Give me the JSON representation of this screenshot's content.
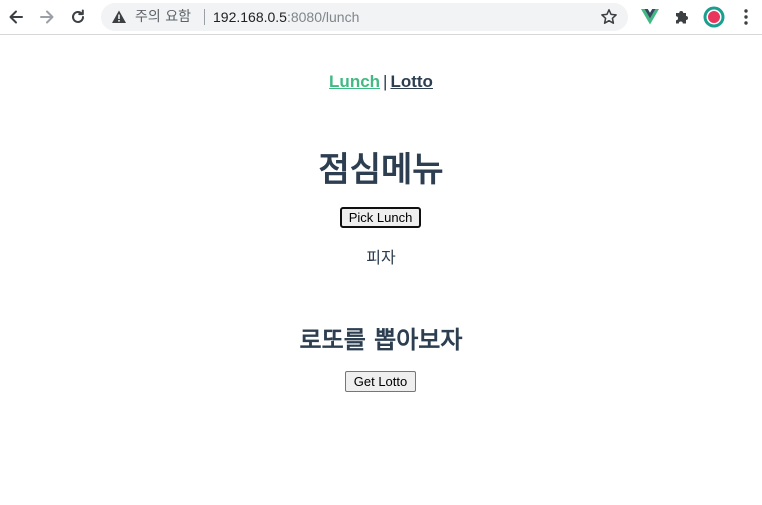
{
  "browser": {
    "security_label": "주의 요함",
    "url_host": "192.168.0.5",
    "url_rest": ":8080/lunch",
    "icons": {
      "back": "arrow-left-icon",
      "forward": "arrow-right-icon",
      "reload": "reload-icon",
      "warning": "warning-icon",
      "bookmark": "star-icon",
      "vue_extension": "vue-icon",
      "extensions": "puzzle-icon",
      "profile": "profile-avatar-icon",
      "menu": "kebab-menu-icon"
    },
    "colors": {
      "vue_green": "#42b983",
      "profile_teal": "#1a9e8f",
      "profile_red": "#e8365d"
    }
  },
  "nav": {
    "lunch_label": "Lunch",
    "separator": "|",
    "lotto_label": "Lotto",
    "active": "Lunch",
    "active_color": "#42b983",
    "text_color": "#2c3e50"
  },
  "lunch": {
    "title": "점심메뉴",
    "pick_button": "Pick Lunch",
    "result": "피자"
  },
  "lotto": {
    "title": "로또를 뽑아보자",
    "get_button": "Get Lotto"
  }
}
